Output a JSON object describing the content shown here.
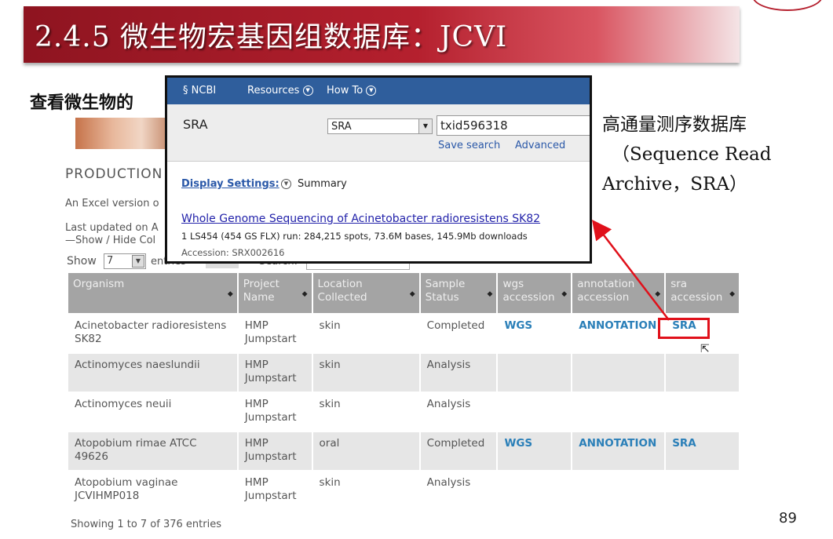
{
  "slide": {
    "title": "2.4.5 微生物宏基因组数据库：JCVI",
    "subtitle": "查看微生物的",
    "right_text": [
      "高通量测序数据库",
      "（Sequence Read",
      "Archive，SRA）"
    ],
    "page_number": "89"
  },
  "jcvi": {
    "heading": "PRODUCTION",
    "excel_text": "An Excel version o",
    "updated_text": "Last updated on A",
    "show_hide": "—Show / Hide Col",
    "show_label": "Show",
    "show_value": "7",
    "entries_label": "entries",
    "search_label": "Search:",
    "footer": "Showing 1 to 7 of 376 entries"
  },
  "table": {
    "headers": [
      "Organism",
      "Project Name",
      "Location Collected",
      "Sample Status",
      "wgs accession",
      "annotation accession",
      "sra accession"
    ],
    "rows": [
      {
        "organism": "Acinetobacter radioresistens SK82",
        "project": "HMP Jumpstart",
        "location": "skin",
        "status": "Completed",
        "wgs": "WGS",
        "annotation": "ANNOTATION",
        "sra": "SRA"
      },
      {
        "organism": "Actinomyces naeslundii",
        "project": "HMP Jumpstart",
        "location": "skin",
        "status": "Analysis",
        "wgs": "",
        "annotation": "",
        "sra": ""
      },
      {
        "organism": "Actinomyces neuii",
        "project": "HMP Jumpstart",
        "location": "skin",
        "status": "Analysis",
        "wgs": "",
        "annotation": "",
        "sra": ""
      },
      {
        "organism": "Atopobium rimae ATCC 49626",
        "project": "HMP Jumpstart",
        "location": "oral",
        "status": "Completed",
        "wgs": "WGS",
        "annotation": "ANNOTATION",
        "sra": "SRA"
      },
      {
        "organism": "Atopobium vaginae JCVIHMP018",
        "project": "HMP Jumpstart",
        "location": "skin",
        "status": "Analysis",
        "wgs": "",
        "annotation": "",
        "sra": ""
      }
    ]
  },
  "ncbi": {
    "logo": "NCBI",
    "resources": "Resources",
    "howto": "How To",
    "database_label": "SRA",
    "db_select": "SRA",
    "search_term": "txid596318",
    "save_search": "Save search",
    "advanced": "Advanced",
    "display_settings": "Display Settings:",
    "summary": "Summary",
    "result_title": "Whole Genome Sequencing of Acinetobacter radioresistens SK82",
    "result_desc": "1 LS454 (454 GS FLX) run: 284,215 spots, 73.6M bases, 145.9Mb downloads",
    "result_accession": "Accession: SRX002616"
  },
  "colors": {
    "title_red": "#b5202e",
    "highlight_red": "#e0101a",
    "ncbi_blue": "#2f5e9c",
    "link_blue": "#2a7fb8",
    "header_gray": "#a4a4a4"
  }
}
